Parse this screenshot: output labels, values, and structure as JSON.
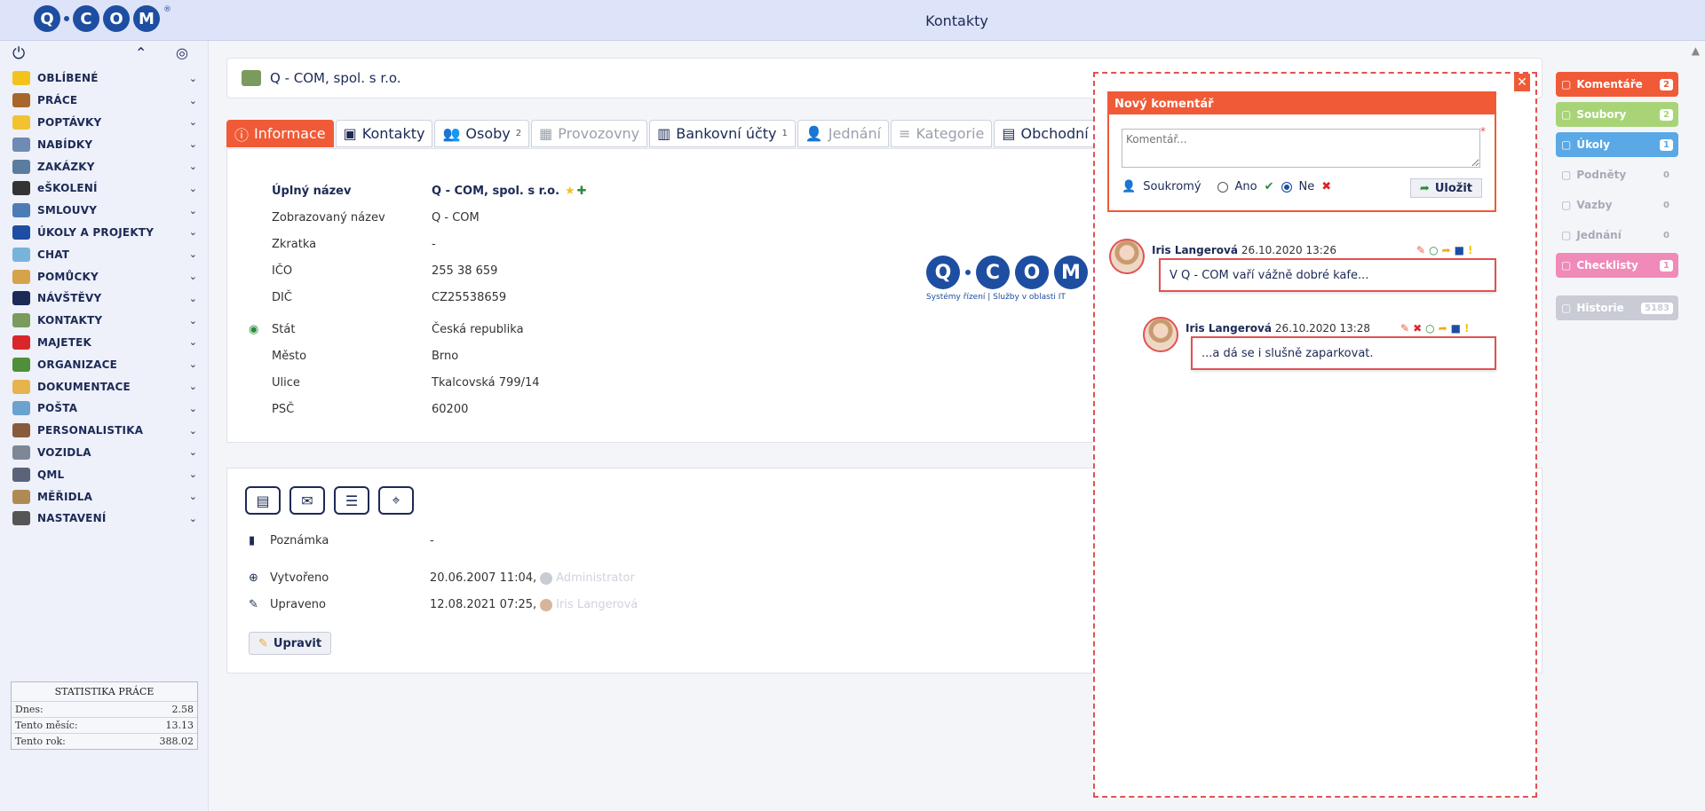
{
  "header": {
    "title": "Kontakty"
  },
  "logo": {
    "letters": [
      "Q",
      "C",
      "O",
      "M"
    ],
    "registered": "®"
  },
  "sidebar": {
    "items": [
      {
        "label": "OBLÍBENÉ",
        "icon": "star-icon",
        "color": "#f3c31c"
      },
      {
        "label": "PRÁCE",
        "icon": "briefcase-icon",
        "color": "#a8662b"
      },
      {
        "label": "POPTÁVKY",
        "icon": "lightbulb-icon",
        "color": "#f2c231"
      },
      {
        "label": "NABÍDKY",
        "icon": "document-icon",
        "color": "#6f8ab3"
      },
      {
        "label": "ZAKÁZKY",
        "icon": "toolbox-icon",
        "color": "#5a7c9e"
      },
      {
        "label": "eŠKOLENÍ",
        "icon": "graduation-cap-icon",
        "color": "#333333"
      },
      {
        "label": "SMLOUVY",
        "icon": "handshake-icon",
        "color": "#4d7bb5"
      },
      {
        "label": "ÚKOLY A PROJEKTY",
        "icon": "clipboard-check-icon",
        "color": "#1d4ea1"
      },
      {
        "label": "CHAT",
        "icon": "chat-bubbles-icon",
        "color": "#78b4d9"
      },
      {
        "label": "POMŮCKY",
        "icon": "supplies-icon",
        "color": "#d6a34a"
      },
      {
        "label": "NÁVŠTĚVY",
        "icon": "walking-person-icon",
        "color": "#1c2a55"
      },
      {
        "label": "KONTAKTY",
        "icon": "contact-card-icon",
        "color": "#7a9a5e"
      },
      {
        "label": "MAJETEK",
        "icon": "red-phone-icon",
        "color": "#d9262b"
      },
      {
        "label": "ORGANIZACE",
        "icon": "books-icon",
        "color": "#4f8f3a"
      },
      {
        "label": "DOKUMENTACE",
        "icon": "folder-document-icon",
        "color": "#e6b34c"
      },
      {
        "label": "POŠTA",
        "icon": "mail-tray-icon",
        "color": "#6ba2cf"
      },
      {
        "label": "PERSONALISTIKA",
        "icon": "people-icon",
        "color": "#8a5a3c"
      },
      {
        "label": "VOZIDLA",
        "icon": "car-icon",
        "color": "#7d8796"
      },
      {
        "label": "QML",
        "icon": "qml-icon",
        "color": "#5a6378"
      },
      {
        "label": "MĚŘIDLA",
        "icon": "ruler-icon",
        "color": "#b08a55"
      },
      {
        "label": "NASTAVENÍ",
        "icon": "tools-icon",
        "color": "#555555"
      }
    ]
  },
  "stats": {
    "title": "STATISTIKA PRÁCE",
    "rows": [
      {
        "label": "Dnes:",
        "value": "2.58"
      },
      {
        "label": "Tento měsíc:",
        "value": "13.13"
      },
      {
        "label": "Tento rok:",
        "value": "388.02"
      }
    ]
  },
  "company": {
    "name": "Q - COM, spol. s r.o."
  },
  "tabs": [
    {
      "label": "Informace",
      "state": "active",
      "icon": "info-icon"
    },
    {
      "label": "Kontakty",
      "state": "normal",
      "icon": "address-book-icon"
    },
    {
      "label": "Osoby",
      "state": "normal",
      "icon": "users-icon",
      "count": "2"
    },
    {
      "label": "Provozovny",
      "state": "disabled",
      "icon": "building-icon"
    },
    {
      "label": "Bankovní účty",
      "state": "normal",
      "icon": "bank-icon",
      "count": "1"
    },
    {
      "label": "Jednání",
      "state": "disabled",
      "icon": "meeting-icon"
    },
    {
      "label": "Kategorie",
      "state": "disabled",
      "icon": "list-icon"
    },
    {
      "label": "Obchodní rejstř",
      "state": "normal",
      "icon": "register-icon"
    }
  ],
  "info": {
    "full_name_label": "Úplný název",
    "full_name": "Q - COM, spol. s r.o.",
    "display_name_label": "Zobrazovaný název",
    "display_name": "Q - COM",
    "abbr_label": "Zkratka",
    "abbr": "-",
    "ico_label": "IČO",
    "ico": "255 38 659",
    "dic_label": "DIČ",
    "dic": "CZ25538659",
    "state_label": "Stát",
    "state": "Česká republika",
    "city_label": "Město",
    "city": "Brno",
    "street_label": "Ulice",
    "street": "Tkalcovská 799/14",
    "zip_label": "PSČ",
    "zip": "60200"
  },
  "brand": {
    "tagline": "Systémy řízení | Služby v oblasti IT"
  },
  "meta": {
    "note_label": "Poznámka",
    "note": "-",
    "created_label": "Vytvořeno",
    "created": "20.06.2007 11:04,",
    "created_by": "Administrator",
    "updated_label": "Upraveno",
    "updated": "12.08.2021 07:25,",
    "updated_by": "Iris Langerová",
    "edit_label": "Upravit"
  },
  "comments_panel": {
    "new_title": "Nový komentář",
    "placeholder": "Komentář...",
    "private_label": "Soukromý",
    "yes_label": "Ano",
    "no_label": "Ne",
    "save_label": "Uložit",
    "comments": [
      {
        "author": "Iris Langerová",
        "date": "26.10.2020 13:26",
        "text": "V Q - COM vaří vážně dobré kafe..."
      },
      {
        "author": "Iris Langerová",
        "date": "26.10.2020 13:28",
        "text": "...a dá se i slušně zaparkovat."
      }
    ]
  },
  "right_rail": [
    {
      "label": "Komentáře",
      "count": "2",
      "color": "#f05a36",
      "state": "active"
    },
    {
      "label": "Soubory",
      "count": "2",
      "color": "#a8d477",
      "state": "active"
    },
    {
      "label": "Úkoly",
      "count": "1",
      "color": "#5aa8e6",
      "state": "active"
    },
    {
      "label": "Podněty",
      "count": "0",
      "color": "",
      "state": "plain"
    },
    {
      "label": "Vazby",
      "count": "0",
      "color": "",
      "state": "plain"
    },
    {
      "label": "Jednání",
      "count": "0",
      "color": "",
      "state": "plain"
    },
    {
      "label": "Checklisty",
      "count": "1",
      "color": "#f08ab9",
      "state": "active"
    },
    {
      "label": "Historie",
      "count": "5183",
      "color": "#c9ccd5",
      "state": "active"
    }
  ]
}
